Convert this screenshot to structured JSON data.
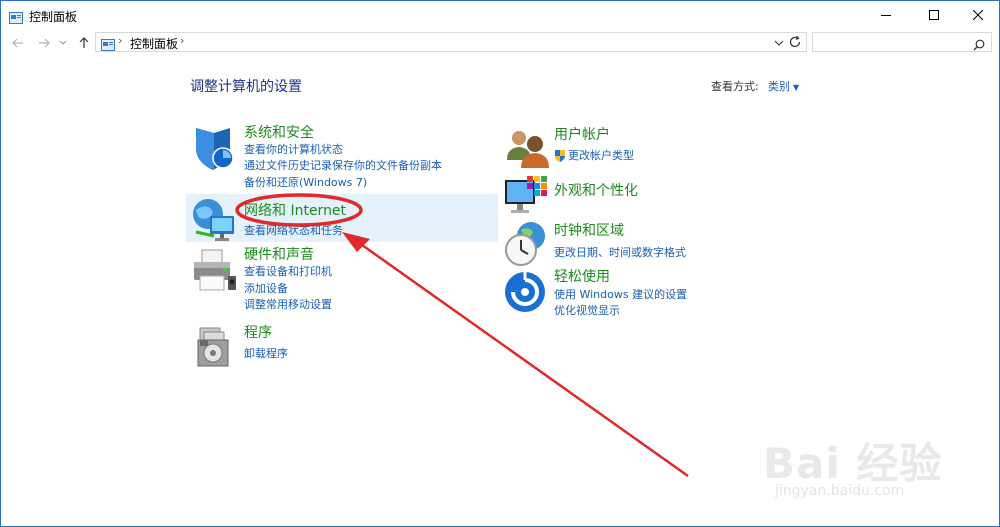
{
  "window": {
    "title": "控制面板",
    "controls": {
      "minimize": "minimize",
      "maximize": "maximize",
      "close": "close"
    }
  },
  "nav": {
    "breadcrumb": "控制面板",
    "search_placeholder": ""
  },
  "main": {
    "heading": "调整计算机的设置",
    "view_by_label": "查看方式:",
    "view_by_value": "类别"
  },
  "categories_left": [
    {
      "title": "系统和安全",
      "icon": "shield-icon",
      "links": [
        "查看你的计算机状态",
        "通过文件历史记录保存你的文件备份副本",
        "备份和还原(Windows 7)"
      ]
    },
    {
      "title": "网络和 Internet",
      "icon": "network-globe-icon",
      "links": [
        "查看网络状态和任务"
      ]
    },
    {
      "title": "硬件和声音",
      "icon": "printer-icon",
      "links": [
        "查看设备和打印机",
        "添加设备",
        "调整常用移动设置"
      ]
    },
    {
      "title": "程序",
      "icon": "programs-icon",
      "links": [
        "卸载程序"
      ]
    }
  ],
  "categories_right": [
    {
      "title": "用户帐户",
      "icon": "users-icon",
      "links": [
        "更改帐户类型"
      ]
    },
    {
      "title": "外观和个性化",
      "icon": "monitor-palette-icon",
      "links": []
    },
    {
      "title": "时钟和区域",
      "icon": "clock-globe-icon",
      "links": [
        "更改日期、时间或数字格式"
      ]
    },
    {
      "title": "轻松使用",
      "icon": "ease-of-access-icon",
      "links": [
        "使用 Windows 建议的设置",
        "优化视觉显示"
      ]
    }
  ],
  "watermark": {
    "brand": "Bai 经验",
    "url": "jingyan.baidu.com"
  },
  "colors": {
    "accent": "#1a5fb4",
    "title_green": "#1e8a1e",
    "annotation_red": "#e02a2a",
    "hover": "#e5f1fb"
  }
}
